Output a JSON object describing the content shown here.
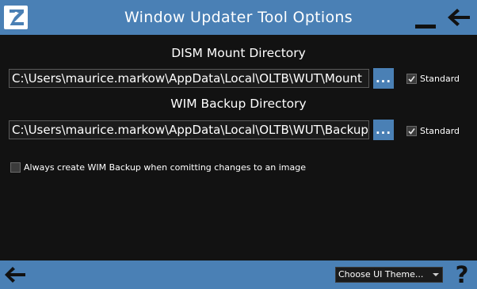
{
  "window": {
    "title": "Window Updater Tool Options",
    "accent_color": "#4a80b5",
    "background_color": "#121212",
    "logo_icon": "app-logo-icon",
    "minimize_icon": "minimize-icon",
    "back_icon": "arrow-left-icon"
  },
  "dism": {
    "label": "DISM Mount Directory",
    "path": "C:\\Users\\maurice.markow\\AppData\\Local\\OLTB\\WUT\\Mount",
    "browse_label": "...",
    "standard_label": "Standard",
    "standard_checked": true
  },
  "wim": {
    "label": "WIM Backup Directory",
    "path": "C:\\Users\\maurice.markow\\AppData\\Local\\OLTB\\WUT\\Backup",
    "browse_label": "...",
    "standard_label": "Standard",
    "standard_checked": true
  },
  "always_backup": {
    "label": "Always create WIM Backup when comitting changes to an image",
    "checked": false
  },
  "footer": {
    "back_icon": "arrow-left-icon",
    "theme_select": "Choose UI Theme...",
    "help_label": "?"
  }
}
